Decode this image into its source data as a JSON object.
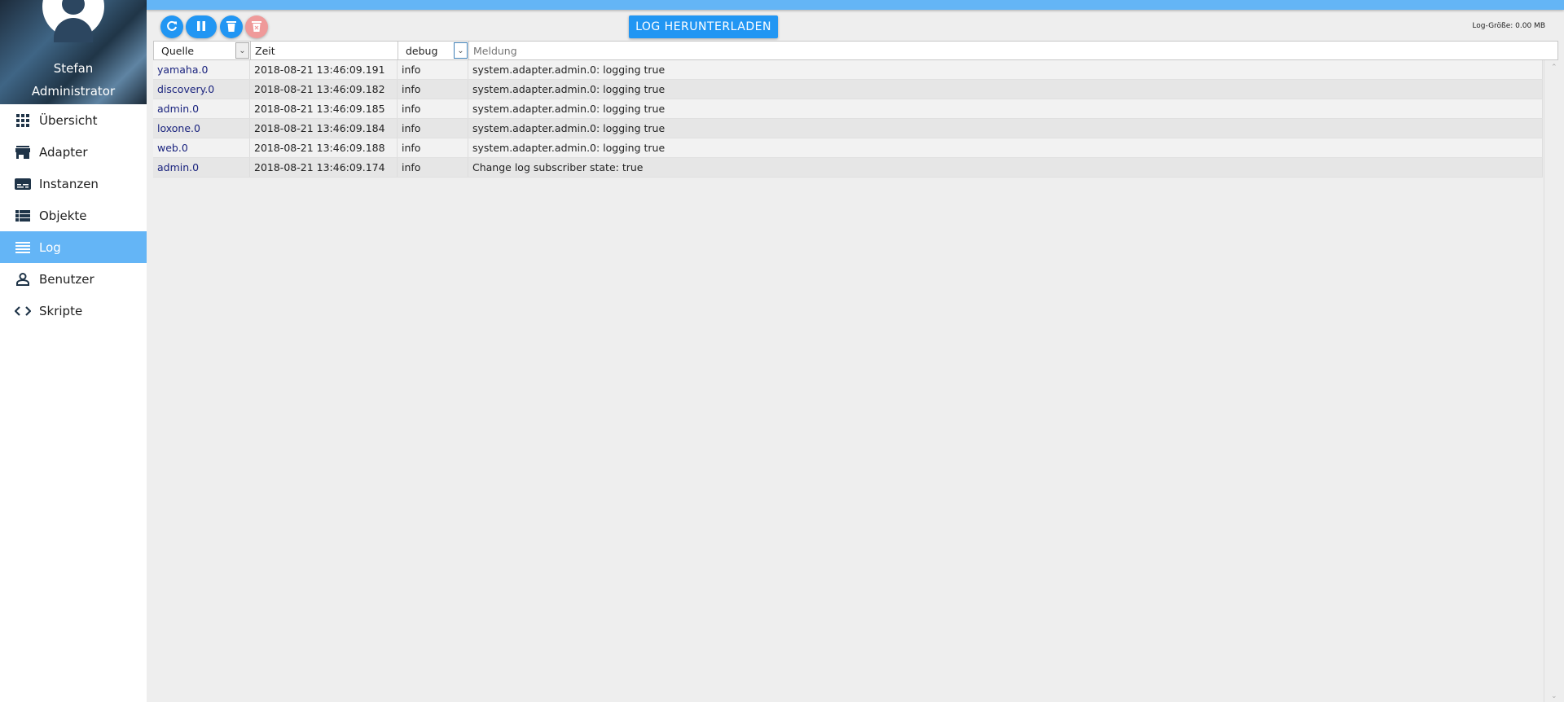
{
  "user": {
    "name": "Stefan",
    "role": "Administrator"
  },
  "nav": [
    {
      "label": "Übersicht",
      "icon": "grid-icon"
    },
    {
      "label": "Adapter",
      "icon": "store-icon"
    },
    {
      "label": "Instanzen",
      "icon": "subtitles-icon"
    },
    {
      "label": "Objekte",
      "icon": "list-icon"
    },
    {
      "label": "Log",
      "icon": "lines-icon",
      "active": true
    },
    {
      "label": "Benutzer",
      "icon": "person-icon"
    },
    {
      "label": "Skripte",
      "icon": "code-icon"
    }
  ],
  "toolbar": {
    "download_label": "LOG HERUNTERLADEN",
    "log_size": "Log-Größe: 0.00 MB"
  },
  "filters": {
    "source": "Quelle",
    "time": "Zeit",
    "level": "debug",
    "message_placeholder": "Meldung"
  },
  "rows": [
    {
      "source": "yamaha.0",
      "time": "2018-08-21 13:46:09.191",
      "level": "info",
      "message": "system.adapter.admin.0: logging true"
    },
    {
      "source": "discovery.0",
      "time": "2018-08-21 13:46:09.182",
      "level": "info",
      "message": "system.adapter.admin.0: logging true"
    },
    {
      "source": "admin.0",
      "time": "2018-08-21 13:46:09.185",
      "level": "info",
      "message": "system.adapter.admin.0: logging true"
    },
    {
      "source": "loxone.0",
      "time": "2018-08-21 13:46:09.184",
      "level": "info",
      "message": "system.adapter.admin.0: logging true"
    },
    {
      "source": "web.0",
      "time": "2018-08-21 13:46:09.188",
      "level": "info",
      "message": "system.adapter.admin.0: logging true"
    },
    {
      "source": "admin.0",
      "time": "2018-08-21 13:46:09.174",
      "level": "info",
      "message": "Change log subscriber state: true"
    }
  ]
}
